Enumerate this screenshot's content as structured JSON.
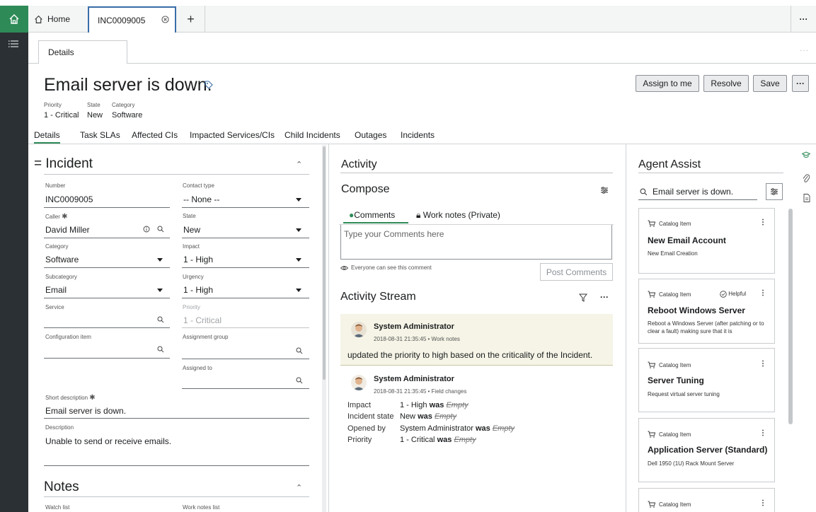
{
  "nav": {
    "home_tab": "Home",
    "record_tab": "INC0009005",
    "add_tab": "+",
    "more": "···"
  },
  "subtab": {
    "label": "Details",
    "more": "···"
  },
  "header": {
    "title": "Email server is down.",
    "meta": [
      {
        "label": "Priority",
        "value": "1 - Critical"
      },
      {
        "label": "State",
        "value": "New"
      },
      {
        "label": "Category",
        "value": "Software"
      }
    ],
    "buttons": {
      "assign": "Assign to me",
      "resolve": "Resolve",
      "save": "Save",
      "more": "···"
    }
  },
  "form_tabs": [
    "Details",
    "Task SLAs",
    "Affected CIs",
    "Impacted Services/CIs",
    "Child Incidents",
    "Outages",
    "Incidents"
  ],
  "incident": {
    "section_title": "Incident",
    "section_prefix": "=",
    "fields": {
      "number": {
        "label": "Number",
        "value": "INC0009005"
      },
      "contact_type": {
        "label": "Contact type",
        "value": "-- None --"
      },
      "caller": {
        "label": "Caller",
        "value": "David Miller",
        "required": "✱"
      },
      "state": {
        "label": "State",
        "value": "New"
      },
      "category": {
        "label": "Category",
        "value": "Software"
      },
      "impact": {
        "label": "Impact",
        "value": "1 - High"
      },
      "subcategory": {
        "label": "Subcategory",
        "value": "Email"
      },
      "urgency": {
        "label": "Urgency",
        "value": "1 - High"
      },
      "service": {
        "label": "Service",
        "value": ""
      },
      "priority": {
        "label": "Priority",
        "value": "1 - Critical"
      },
      "config_item": {
        "label": "Configuration item",
        "value": ""
      },
      "assignment_group": {
        "label": "Assignment group",
        "value": ""
      },
      "assigned_to": {
        "label": "Assigned to",
        "value": ""
      },
      "short_description": {
        "label": "Short description",
        "value": "Email server is down.",
        "required": "✱"
      },
      "description": {
        "label": "Description",
        "value": "Unable to send or receive emails."
      }
    }
  },
  "notes": {
    "section_title": "Notes",
    "watch_list": "Watch list",
    "work_notes_list": "Work notes list"
  },
  "activity": {
    "title": "Activity",
    "compose": "Compose",
    "tabs": {
      "comments": "Comments",
      "work_notes": "Work notes (Private)"
    },
    "placeholder": "Type your Comments here",
    "visibility_note": "Everyone can see this comment",
    "post_button": "Post Comments",
    "stream_title": "Activity Stream",
    "entries": [
      {
        "author": "System Administrator",
        "meta": "2018-08-31 21:35:45 • Work notes",
        "text": "updated the priority to high based on the criticality of the Incident."
      },
      {
        "author": "System Administrator",
        "meta": "2018-08-31 21:35:45 • Field changes",
        "changes": [
          {
            "field": "Impact",
            "value": "1 - High",
            "was": "was",
            "old": "Empty"
          },
          {
            "field": "Incident state",
            "value": "New",
            "was": "was",
            "old": "Empty"
          },
          {
            "field": "Opened by",
            "value": "System Administrator",
            "was": "was",
            "old": "Empty"
          },
          {
            "field": "Priority",
            "value": "1 - Critical",
            "was": "was",
            "old": "Empty"
          }
        ]
      }
    ]
  },
  "agent_assist": {
    "title": "Agent Assist",
    "search_value": "Email server is down.",
    "cards": [
      {
        "type": "Catalog Item",
        "title": "New Email Account",
        "desc": "New Email Creation",
        "helpful": ""
      },
      {
        "type": "Catalog Item",
        "title": "Reboot Windows Server",
        "desc": "Reboot a Windows Server (after patching or to clear a fault) making sure that it is",
        "helpful": "Helpful"
      },
      {
        "type": "Catalog Item",
        "title": "Server Tuning",
        "desc": "Request virtual server tuning",
        "helpful": ""
      },
      {
        "type": "Catalog Item",
        "title": "Application Server (Standard)",
        "desc": "Dell 1950 (1U) Rack Mount Server",
        "helpful": ""
      },
      {
        "type": "Catalog Item",
        "title": "",
        "desc": "",
        "helpful": ""
      }
    ],
    "kebab": "⋮"
  },
  "colors": {
    "rail": "#2b3034",
    "home_active": "#2e8b57",
    "accent": "#2e8b57",
    "record_tab_border": "#3a6ea8"
  }
}
